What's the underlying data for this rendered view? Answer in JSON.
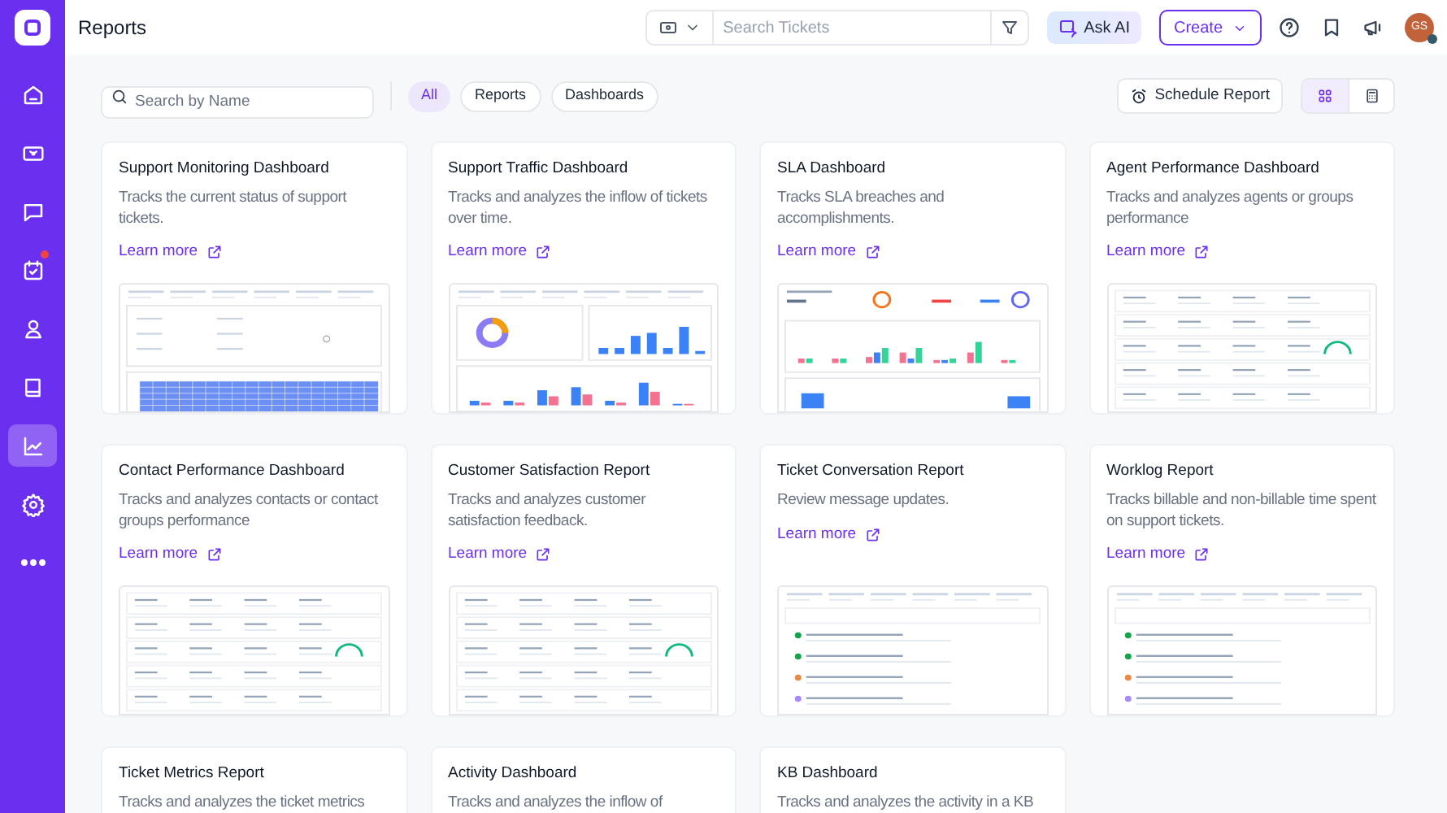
{
  "header": {
    "title": "Reports",
    "search": {
      "placeholder": "Search Tickets"
    },
    "ask_ai": "Ask AI",
    "create": "Create",
    "avatar": {
      "initials": "GS",
      "online": true
    }
  },
  "sidebar": {
    "items": [
      {
        "selected": false,
        "notification": false
      },
      {
        "selected": false,
        "notification": false
      },
      {
        "selected": false,
        "notification": false
      },
      {
        "selected": false,
        "notification": true
      },
      {
        "selected": false,
        "notification": false
      },
      {
        "selected": false,
        "notification": false
      },
      {
        "selected": true,
        "notification": false
      },
      {
        "selected": false,
        "notification": false
      },
      {
        "selected": false,
        "notification": false
      }
    ]
  },
  "toolbar": {
    "search": {
      "placeholder": "Search by Name"
    },
    "filters": [
      {
        "label": "All",
        "selected": true
      },
      {
        "label": "Reports",
        "selected": false
      },
      {
        "label": "Dashboards",
        "selected": false
      }
    ],
    "schedule": "Schedule Report",
    "views": [
      {
        "kind": "grid",
        "selected": true
      },
      {
        "kind": "table",
        "selected": false
      }
    ]
  },
  "cards": [
    {
      "title": "Support Monitoring Dashboard",
      "description": "Tracks the current status of support tickets.",
      "link": "Learn more",
      "kind": "table"
    },
    {
      "title": "Support Traffic Dashboard",
      "description": "Tracks and analyzes the inflow of tickets over time.",
      "link": "Learn more",
      "kind": "bars"
    },
    {
      "title": "SLA Dashboard",
      "description": "Tracks SLA breaches and accomplishments.",
      "link": "Learn more",
      "kind": "sla"
    },
    {
      "title": "Agent Performance Dashboard",
      "description": "Tracks and analyzes agents or groups performance",
      "link": "Learn more",
      "kind": "metrics"
    },
    {
      "title": "Contact Performance Dashboard",
      "description": "Tracks and analyzes contacts or contact groups performance",
      "link": "Learn more",
      "kind": "metrics"
    },
    {
      "title": "Customer Satisfaction Report",
      "description": "Tracks and analyzes customer satisfaction feedback.",
      "link": "Learn more",
      "kind": "metrics"
    },
    {
      "title": "Ticket Conversation Report",
      "description": "Review message updates.",
      "link": "Learn more",
      "kind": "list"
    },
    {
      "title": "Worklog Report",
      "description": "Tracks billable and non-billable time spent on support tickets.",
      "link": "Learn more",
      "kind": "list"
    },
    {
      "title": "Ticket Metrics Report",
      "description": "Tracks and analyzes the ticket metrics"
    },
    {
      "title": "Activity Dashboard",
      "description": "Tracks and analyzes the inflow of"
    },
    {
      "title": "KB Dashboard",
      "description": "Tracks and analyzes the activity in a KB"
    }
  ]
}
